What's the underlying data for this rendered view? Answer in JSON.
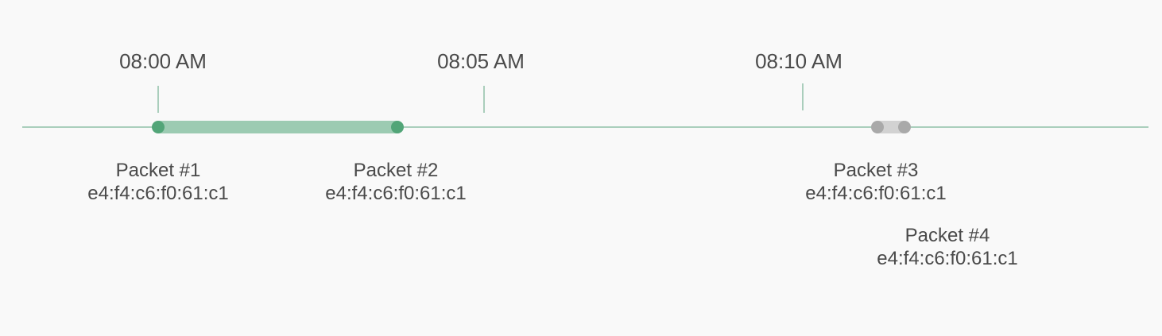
{
  "timeline": {
    "ticks": [
      {
        "label": "08:00 AM"
      },
      {
        "label": "08:05 AM"
      },
      {
        "label": "08:10 AM"
      }
    ],
    "packets": [
      {
        "name": "Packet #1",
        "mac": "e4:f4:c6:f0:61:c1"
      },
      {
        "name": "Packet #2",
        "mac": "e4:f4:c6:f0:61:c1"
      },
      {
        "name": "Packet #3",
        "mac": "e4:f4:c6:f0:61:c1"
      },
      {
        "name": "Packet #4",
        "mac": "e4:f4:c6:f0:61:c1"
      }
    ],
    "colors": {
      "axis": "#5aa37f",
      "active_segment": "#9ccbb2",
      "active_dot": "#52a578",
      "inactive_segment": "#d2d2d2",
      "inactive_dot": "#a9a9a9",
      "text": "#4a4a4a"
    }
  }
}
